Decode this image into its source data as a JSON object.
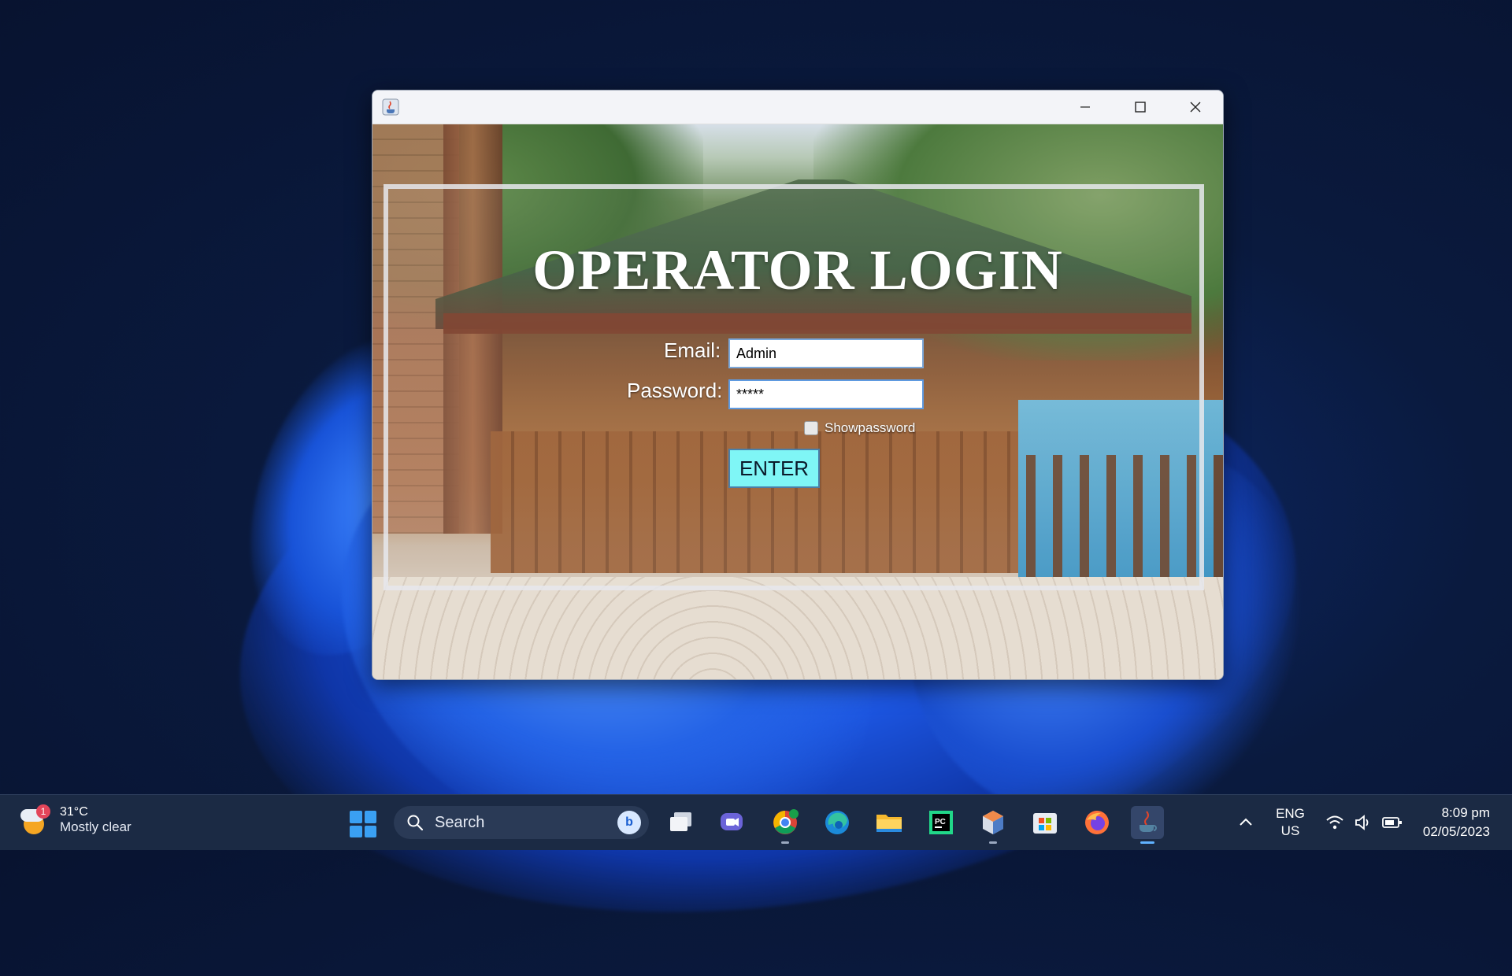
{
  "window": {
    "title": ""
  },
  "login": {
    "title": "OPERATOR LOGIN",
    "email_label": "Email:",
    "email_value": "Admin",
    "password_label": "Password:",
    "password_value": "*****",
    "show_password_label": "Showpassword",
    "show_password_checked": false,
    "enter_label": "ENTER",
    "enter_button_color": "#7ff6f6"
  },
  "taskbar": {
    "weather": {
      "temp": "31°C",
      "condition": "Mostly clear",
      "badge": "1"
    },
    "search": {
      "label": "Search"
    },
    "apps": [
      {
        "name": "task-view-icon"
      },
      {
        "name": "meet-icon"
      },
      {
        "name": "chrome-icon",
        "badge": "N"
      },
      {
        "name": "edge-icon"
      },
      {
        "name": "file-explorer-icon"
      },
      {
        "name": "pycharm-icon",
        "label": "PC"
      },
      {
        "name": "virtualbox-icon"
      },
      {
        "name": "microsoft-store-icon"
      },
      {
        "name": "firefox-icon"
      },
      {
        "name": "java-icon"
      }
    ],
    "language": {
      "line1": "ENG",
      "line2": "US"
    },
    "clock": {
      "time": "8:09 pm",
      "date": "02/05/2023"
    }
  }
}
